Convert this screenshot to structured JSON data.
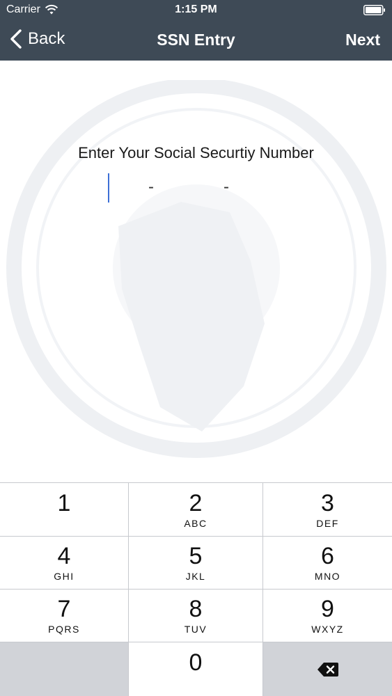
{
  "status_bar": {
    "carrier": "Carrier",
    "time": "1:15 PM",
    "wifi_icon": "wifi-icon",
    "battery_icon": "battery-icon"
  },
  "nav_bar": {
    "back_label": "Back",
    "title": "SSN Entry",
    "next_label": "Next",
    "background_color": "#3e4a56",
    "back_icon": "chevron-left-icon"
  },
  "content": {
    "prompt": "Enter Your Social Securtiy Number",
    "ssn_value": "",
    "separator": "-",
    "cursor_color": "#3d6fd6",
    "watermark_icon": "seal-watermark"
  },
  "keypad": {
    "keys": [
      {
        "num": "1",
        "letters": ""
      },
      {
        "num": "2",
        "letters": "ABC"
      },
      {
        "num": "3",
        "letters": "DEF"
      },
      {
        "num": "4",
        "letters": "GHI"
      },
      {
        "num": "5",
        "letters": "JKL"
      },
      {
        "num": "6",
        "letters": "MNO"
      },
      {
        "num": "7",
        "letters": "PQRS"
      },
      {
        "num": "8",
        "letters": "TUV"
      },
      {
        "num": "9",
        "letters": "WXYZ"
      },
      {
        "num": "0",
        "letters": ""
      }
    ],
    "delete_icon": "delete-icon"
  }
}
